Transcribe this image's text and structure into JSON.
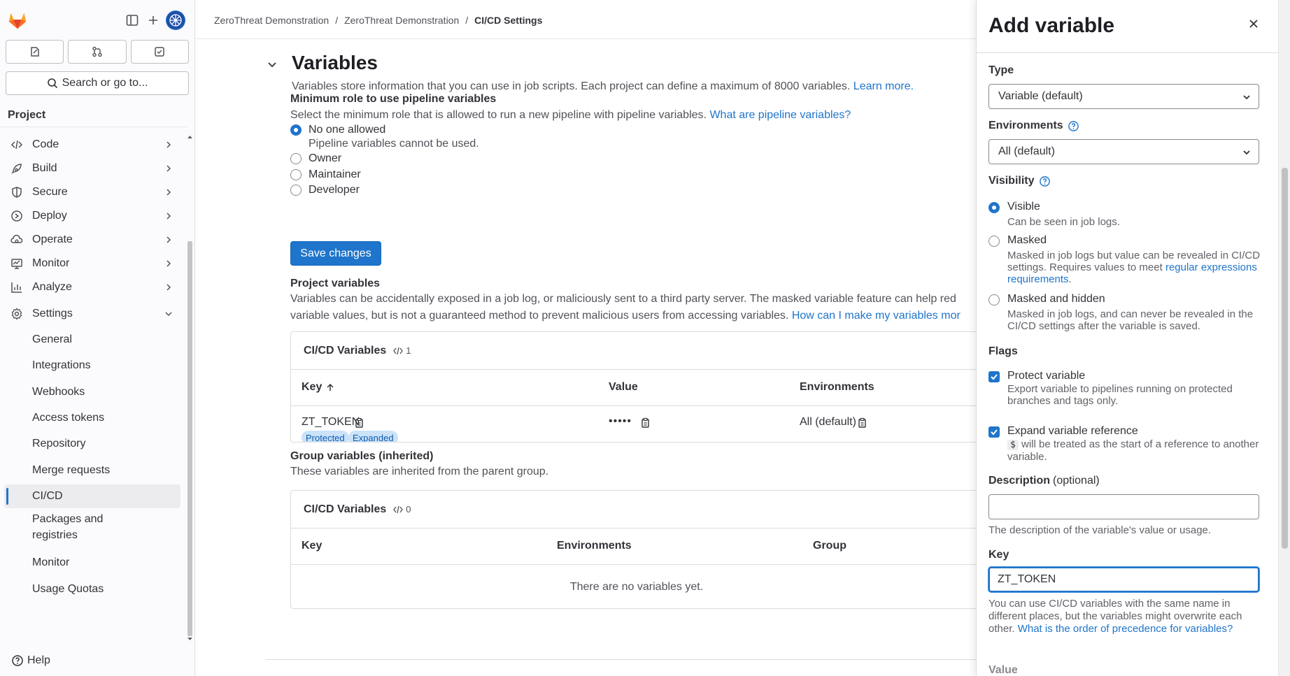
{
  "sidebar": {
    "search_label": "Search or go to...",
    "section_title": "Project",
    "help_label": "Help",
    "items": [
      {
        "label": "Code",
        "icon": "code-icon"
      },
      {
        "label": "Build",
        "icon": "rocket-icon"
      },
      {
        "label": "Secure",
        "icon": "shield-icon"
      },
      {
        "label": "Deploy",
        "icon": "deploy-icon"
      },
      {
        "label": "Operate",
        "icon": "cloud-gear-icon"
      },
      {
        "label": "Monitor",
        "icon": "monitor-icon"
      },
      {
        "label": "Analyze",
        "icon": "chart-icon"
      },
      {
        "label": "Settings",
        "icon": "gear-icon"
      }
    ],
    "settings_sub": [
      "General",
      "Integrations",
      "Webhooks",
      "Access tokens",
      "Repository",
      "Merge requests",
      "CI/CD",
      "Packages and registries",
      "Monitor",
      "Usage Quotas"
    ],
    "active_sub": "CI/CD"
  },
  "breadcrumbs": [
    "ZeroThreat Demonstration",
    "/",
    "ZeroThreat Demonstration",
    "/",
    "CI/CD Settings"
  ],
  "variables_section": {
    "title": "Variables",
    "description": "Variables store information that you can use in job scripts. Each project can define a maximum of 8000 variables.",
    "learn_more": "Learn more.",
    "min_role_title": "Minimum role to use pipeline variables",
    "min_role_desc": "Select the minimum role that is allowed to run a new pipeline with pipeline variables.",
    "min_role_link": "What are pipeline variables?",
    "roles": [
      {
        "label": "No one allowed",
        "checked": true,
        "help": "Pipeline variables cannot be used."
      },
      {
        "label": "Owner",
        "checked": false
      },
      {
        "label": "Maintainer",
        "checked": false
      },
      {
        "label": "Developer",
        "checked": false
      }
    ],
    "save_label": "Save changes",
    "project_vars_title": "Project variables",
    "project_vars_desc_1": "Variables can be accidentally exposed in a job log, or maliciously sent to a third party server. The masked variable feature can help red",
    "project_vars_desc_2": "variable values, but is not a guaranteed method to prevent malicious users from accessing variables.",
    "project_vars_link": "How can I make my variables mor",
    "project_card": {
      "title": "CI/CD Variables",
      "count": "1",
      "columns": [
        "Key",
        "Value",
        "Environments"
      ],
      "rows": [
        {
          "key": "ZT_TOKEN",
          "value": "•••••",
          "environments": "All (default)",
          "badges": [
            "Protected",
            "Expanded"
          ]
        }
      ]
    },
    "group_vars_title": "Group variables (inherited)",
    "group_vars_desc": "These variables are inherited from the parent group.",
    "group_card": {
      "title": "CI/CD Variables",
      "count": "0",
      "columns": [
        "Key",
        "Environments",
        "Group"
      ],
      "empty": "There are no variables yet."
    }
  },
  "drawer": {
    "title": "Add variable",
    "type_label": "Type",
    "type_value": "Variable (default)",
    "env_label": "Environments",
    "env_value": "All (default)",
    "visibility_label": "Visibility",
    "visibility_options": [
      {
        "label": "Visible",
        "checked": true,
        "help": "Can be seen in job logs."
      },
      {
        "label": "Masked",
        "checked": false,
        "help": "Masked in job logs but value can be revealed in CI/CD settings. Requires values to meet",
        "link": "regular expressions requirements",
        "after": "."
      },
      {
        "label": "Masked and hidden",
        "checked": false,
        "help": "Masked in job logs, and can never be revealed in the CI/CD settings after the variable is saved."
      }
    ],
    "flags_label": "Flags",
    "flags": [
      {
        "label": "Protect variable",
        "checked": true,
        "help": "Export variable to pipelines running on protected branches and tags only."
      },
      {
        "label": "Expand variable reference",
        "checked": true,
        "code": "$",
        "help": "will be treated as the start of a reference to another variable."
      }
    ],
    "description_label": "Description",
    "description_optional": "(optional)",
    "description_value": "",
    "description_help": "The description of the variable's value or usage.",
    "key_label": "Key",
    "key_value": "ZT_TOKEN",
    "key_help": "You can use CI/CD variables with the same name in different places, but the variables might overwrite each other.",
    "key_help_link": "What is the order of precedence for variables?",
    "value_label": "Value"
  },
  "colors": {
    "accent": "#1f75cb",
    "badge_bg": "#cbe2f9",
    "badge_text": "#0b5cad",
    "logo": "#e24329"
  }
}
